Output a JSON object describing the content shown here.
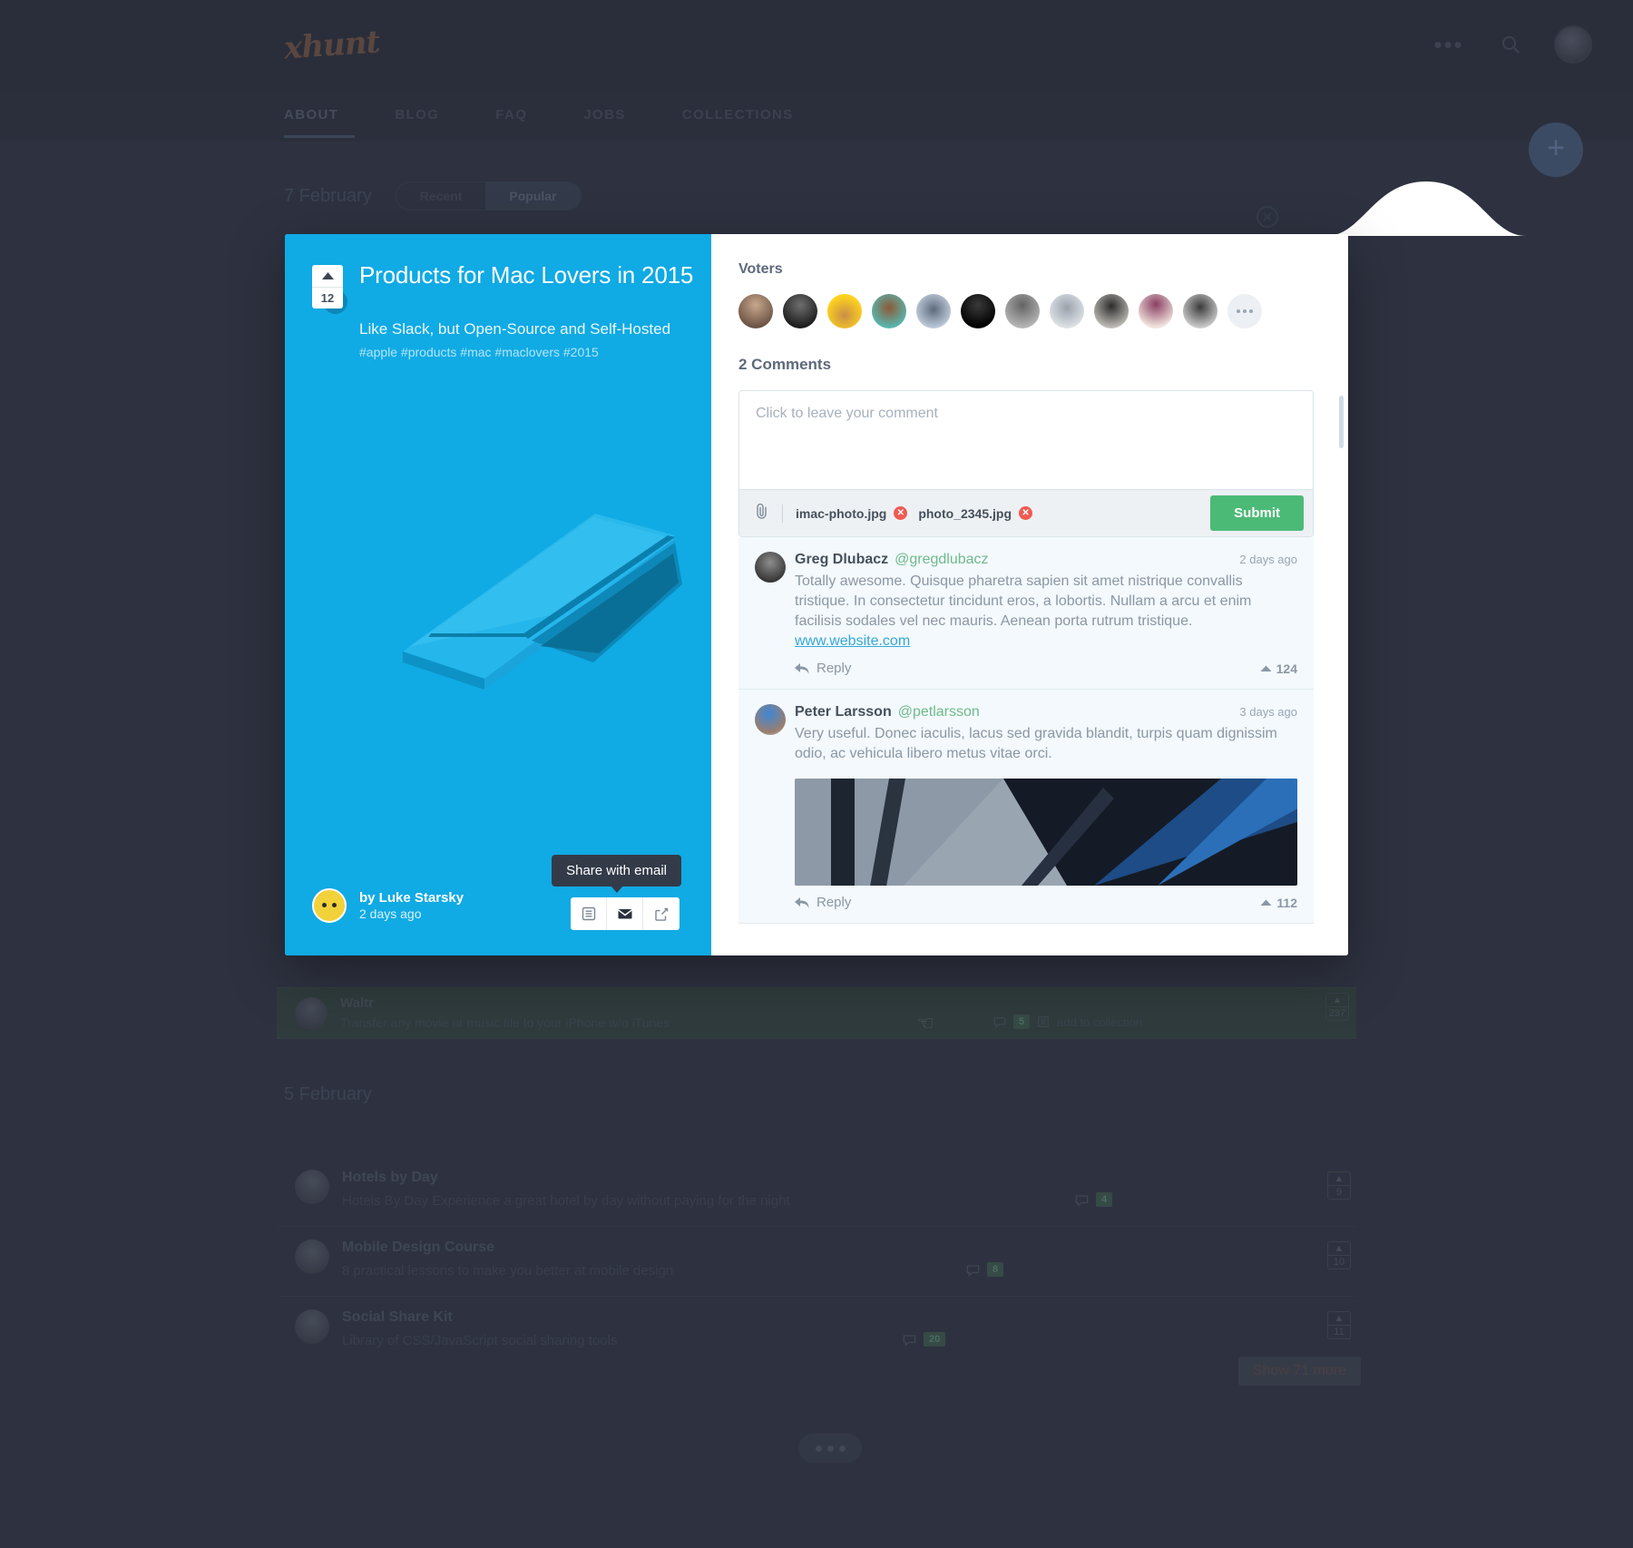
{
  "app": {
    "logo": "xhunt",
    "nav": [
      {
        "label": "ABOUT",
        "active": true
      },
      {
        "label": "BLOG",
        "active": false
      },
      {
        "label": "FAQ",
        "active": false
      },
      {
        "label": "JOBS",
        "active": false
      },
      {
        "label": "COLLECTIONS",
        "active": false
      }
    ],
    "top_icons": {
      "more": "more-dots-icon",
      "search": "search-icon",
      "avatar": "user-avatar"
    },
    "fab_label": "+",
    "date_header": "7 February",
    "toggle": {
      "recent": "Recent",
      "popular": "Popular",
      "selected": "Popular"
    },
    "second_date_header": "5 February",
    "show_more": "Show 71 more"
  },
  "hovered_row": {
    "title": "Waltr",
    "subtitle": "Transfer any movie or music file to your iPhone w/o iTunes",
    "comments": "5",
    "action": "add to collection",
    "votes": "237"
  },
  "bg_items": [
    {
      "title": "Hotels by Day",
      "subtitle": "Hotels By Day Experience a great hotel by day without paying for the night",
      "comments": "4",
      "votes": "9"
    },
    {
      "title": "Mobile Design Course",
      "subtitle": "8 practical lessons to make you better at mobile design",
      "comments": "8",
      "votes": "10"
    },
    {
      "title": "Social Share Kit",
      "subtitle": "Library of CSS/JavaScript social sharing tools",
      "comments": "20",
      "votes": "11"
    }
  ],
  "modal": {
    "close_icon": "close-circle-icon",
    "post": {
      "votes": "12",
      "title": "Products for Mac Lovers in 2015",
      "subtitle": "Like Slack, but Open-Source and Self-Hosted",
      "tags": "#apple #products #mac #maclovers #2015",
      "link_icon": "link-icon",
      "author_prefix": "by Luke Starsky",
      "author_time": "2 days ago",
      "share_tooltip": "Share with email",
      "share_buttons": [
        {
          "icon": "collection-icon",
          "name": "add-to-collection-button"
        },
        {
          "icon": "envelope-icon",
          "name": "share-email-button"
        },
        {
          "icon": "share-external-icon",
          "name": "share-external-button"
        }
      ]
    },
    "voters_label": "Voters",
    "voters": [
      {
        "c1": "#c9a88c",
        "c2": "#6b5344"
      },
      {
        "c1": "#6f6f6f",
        "c2": "#1d1d1d"
      },
      {
        "c1": "#ffd21e",
        "c2": "#c98f46"
      },
      {
        "c1": "#54bdb7",
        "c2": "#8d5a37"
      },
      {
        "c1": "#c8d4e2",
        "c2": "#5d6b7e"
      },
      {
        "c1": "#1a1a1a",
        "c2": "#000000"
      },
      {
        "c1": "#bfbfbf",
        "c2": "#636363"
      },
      {
        "c1": "#e3e7ea",
        "c2": "#9aa2ad"
      },
      {
        "c1": "#2c2c2c",
        "c2": "#d7d2cc"
      },
      {
        "c1": "#f0e2dc",
        "c2": "#8a3f63"
      },
      {
        "c1": "#d9d9d9",
        "c2": "#3b3b3b"
      }
    ],
    "voters_more_icon": "more-dots-icon",
    "comments_count_label": "2 Comments",
    "composer": {
      "placeholder": "Click to leave your comment",
      "value": "",
      "attach_icon": "paperclip-icon",
      "attachments": [
        "imac-photo.jpg",
        "photo_2345.jpg"
      ],
      "remove_icon": "remove-circle-icon",
      "submit_label": "Submit"
    },
    "comments": [
      {
        "name": "Greg Dlubacz",
        "handle": "@gregdlubacz",
        "time": "2 days ago",
        "text": "Totally awesome. Quisque pharetra sapien sit amet nistrique convallis tristique. In consectetur tincidunt eros, a lobortis. Nullam a arcu et enim facilisis sodales vel nec mauris. Aenean porta rutrum tristique. ",
        "link": "www.website.com",
        "reply_label": "Reply",
        "upvotes": "124",
        "has_image": false
      },
      {
        "name": "Peter Larsson",
        "handle": "@petlarsson",
        "time": "3 days ago",
        "text": "Very useful. Donec iaculis, lacus sed gravida blandit, turpis quam dignissim odio, ac vehicula libero metus vitae orci.",
        "link": "",
        "reply_label": "Reply",
        "upvotes": "112",
        "has_image": true
      }
    ]
  },
  "colors": {
    "accent_blue": "#10aae4",
    "submit_green": "#4cba77",
    "handle_green": "#6fba8c",
    "link_blue": "#36a8d8",
    "bg_dark": "#2e3240",
    "remove_red": "#ef5b52"
  }
}
